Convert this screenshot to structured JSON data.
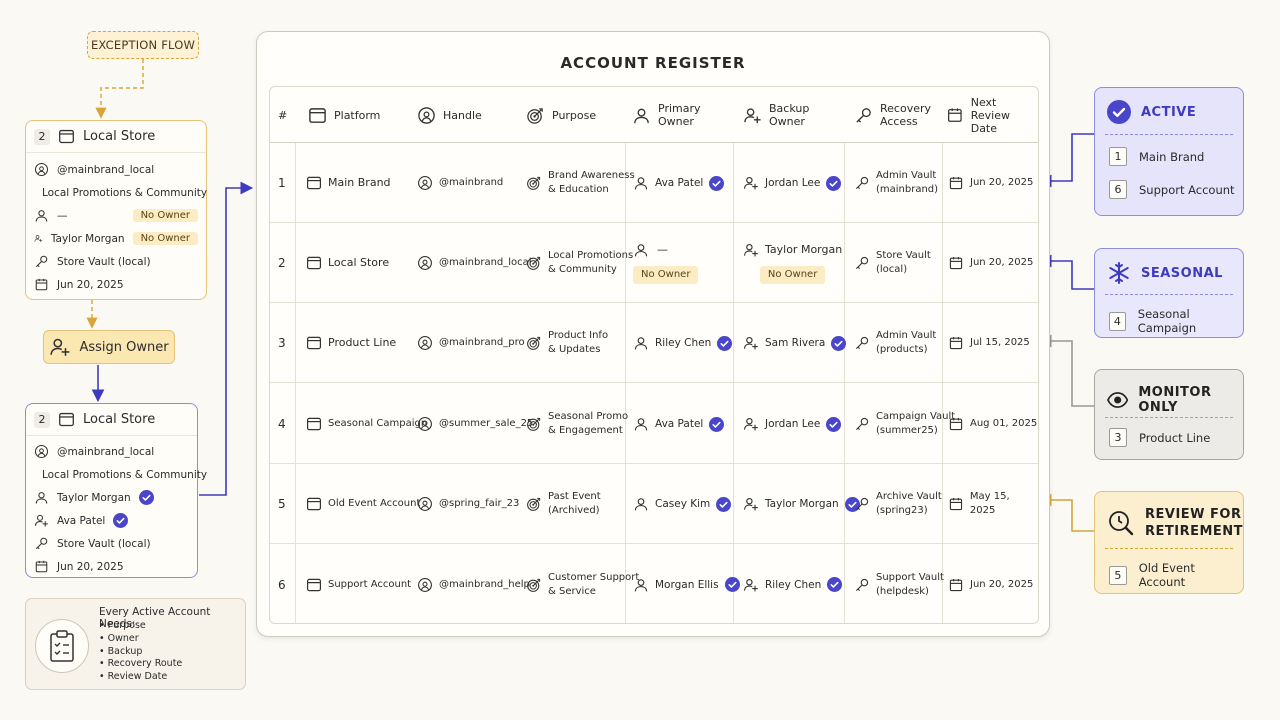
{
  "exception_flow": {
    "label": "EXCEPTION FLOW"
  },
  "card_before": {
    "num": "2",
    "title": "Local Store",
    "handle": "@mainbrand_local",
    "purpose": "Local Promotions & Community",
    "primary": "—",
    "primary_badge": "No Owner",
    "backup": "Taylor Morgan",
    "backup_badge": "No Owner",
    "recovery": "Store Vault (local)",
    "review": "Jun 20, 2025"
  },
  "assign_owner": {
    "label": "Assign Owner"
  },
  "card_after": {
    "num": "2",
    "title": "Local Store",
    "handle": "@mainbrand_local",
    "purpose": "Local Promotions & Community",
    "primary": "Taylor Morgan",
    "backup": "Ava Patel",
    "recovery": "Store Vault (local)",
    "review": "Jun 20, 2025"
  },
  "needs": {
    "title": "Every Active Account Needs:",
    "items": [
      "Purpose",
      "Owner",
      "Backup",
      "Recovery Route",
      "Review Date"
    ]
  },
  "register": {
    "title": "ACCOUNT REGISTER",
    "headers": {
      "num": "#",
      "platform": "Platform",
      "handle": "Handle",
      "purpose": "Purpose",
      "primary_1": "Primary",
      "primary_2": "Owner",
      "backup_1": "Backup",
      "backup_2": "Owner",
      "recovery_1": "Recovery",
      "recovery_2": "Access",
      "review_1": "Next Review",
      "review_2": "Date"
    },
    "rows": [
      {
        "num": "1",
        "platform": "Main Brand",
        "handle": "@mainbrand",
        "purpose_1": "Brand Awareness",
        "purpose_2": "& Education",
        "primary": "Ava Patel",
        "backup": "Jordan Lee",
        "recovery_1": "Admin Vault",
        "recovery_2": "(mainbrand)",
        "review": "Jun 20, 2025"
      },
      {
        "num": "2",
        "platform": "Local Store",
        "handle": "@mainbrand_local",
        "purpose_1": "Local Promotions",
        "purpose_2": "& Community",
        "primary": "—",
        "primary_badge": "No Owner",
        "backup": "Taylor Morgan",
        "backup_badge": "No Owner",
        "recovery_1": "Store Vault",
        "recovery_2": "(local)",
        "review": "Jun 20, 2025"
      },
      {
        "num": "3",
        "platform": "Product Line",
        "handle": "@mainbrand_pro",
        "purpose_1": "Product Info",
        "purpose_2": "& Updates",
        "primary": "Riley Chen",
        "backup": "Sam Rivera",
        "recovery_1": "Admin Vault",
        "recovery_2": "(products)",
        "review": "Jul 15, 2025"
      },
      {
        "num": "4",
        "platform": "Seasonal Campaign",
        "handle": "@summer_sale_25",
        "purpose_1": "Seasonal Promo",
        "purpose_2": "& Engagement",
        "primary": "Ava Patel",
        "backup": "Jordan Lee",
        "recovery_1": "Campaign Vault",
        "recovery_2": "(summer25)",
        "review": "Aug 01, 2025"
      },
      {
        "num": "5",
        "platform": "Old Event Account",
        "handle": "@spring_fair_23",
        "purpose_1": "Past Event",
        "purpose_2": "(Archived)",
        "primary": "Casey Kim",
        "backup": "Taylor Morgan",
        "recovery_1": "Archive Vault",
        "recovery_2": "(spring23)",
        "review": "May 15, 2025"
      },
      {
        "num": "6",
        "platform": "Support Account",
        "handle": "@mainbrand_help",
        "purpose_1": "Customer Support",
        "purpose_2": "& Service",
        "primary": "Morgan Ellis",
        "backup": "Riley Chen",
        "recovery_1": "Support Vault",
        "recovery_2": "(helpdesk)",
        "review": "Jun 20, 2025"
      }
    ]
  },
  "status": {
    "active": {
      "title": "ACTIVE",
      "items": [
        {
          "num": "1",
          "label": "Main Brand"
        },
        {
          "num": "6",
          "label": "Support Account"
        }
      ],
      "color": "#4a46c9"
    },
    "seasonal": {
      "title": "SEASONAL",
      "items": [
        {
          "num": "4",
          "label": "Seasonal Campaign"
        }
      ],
      "color": "#4a46c9"
    },
    "monitor": {
      "title": "MONITOR ONLY",
      "items": [
        {
          "num": "3",
          "label": "Product Line"
        }
      ],
      "color": "#8d8a84"
    },
    "review": {
      "title_1": "REVIEW FOR",
      "title_2": "RETIREMENT",
      "items": [
        {
          "num": "5",
          "label": "Old Event Account"
        }
      ],
      "color": "#d4a63a"
    }
  },
  "icons": [
    "window-icon",
    "user-icon",
    "target-icon",
    "user-plus-icon",
    "key-icon",
    "calendar-icon",
    "check-icon",
    "snowflake-icon",
    "eye-icon",
    "clock-search-icon",
    "clipboard-icon"
  ]
}
